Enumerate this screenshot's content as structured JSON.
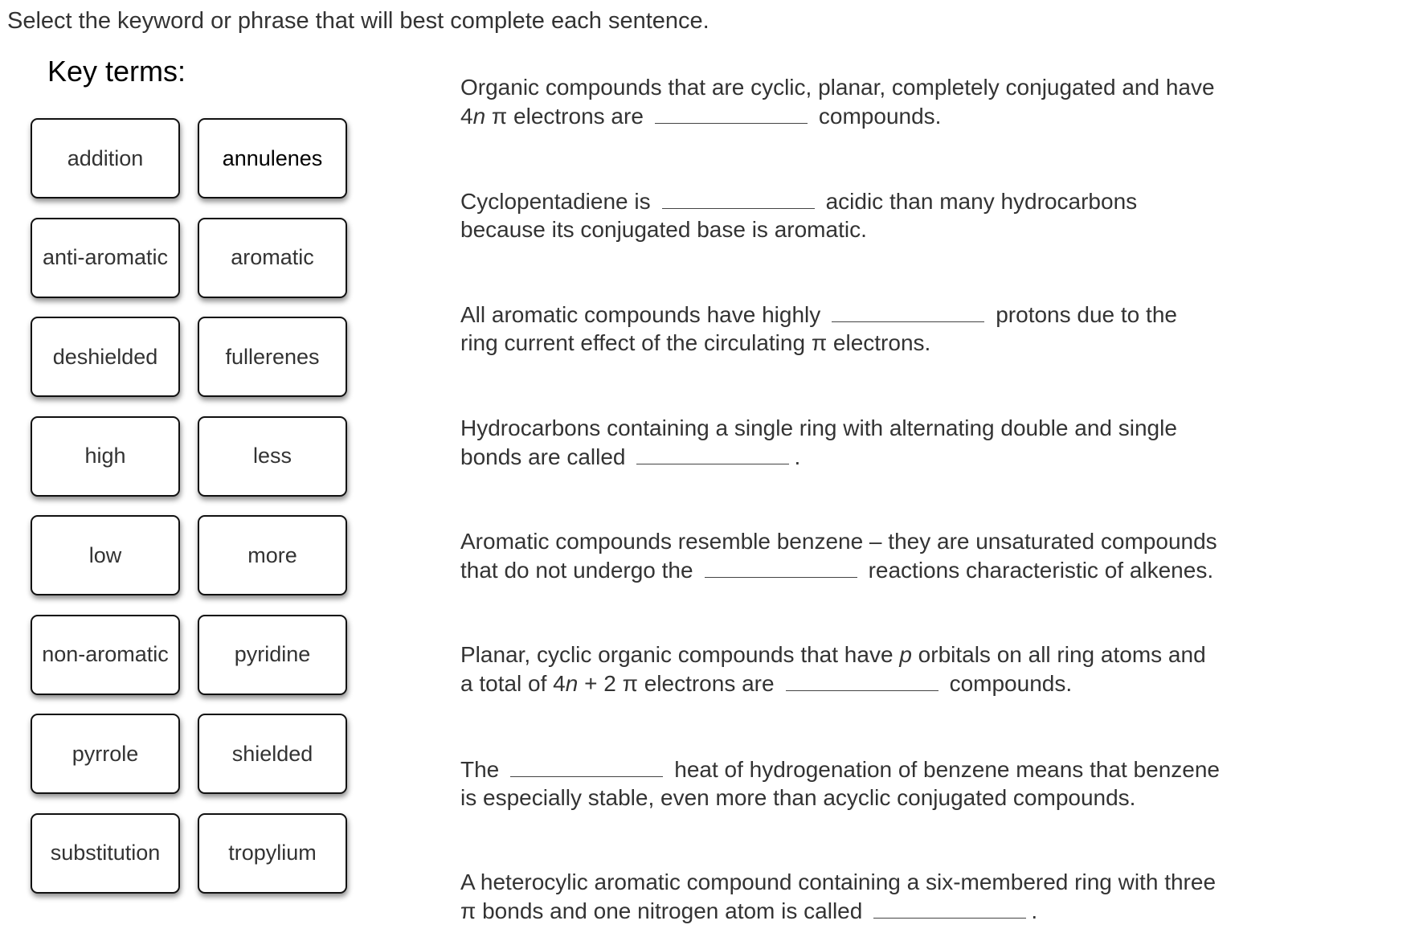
{
  "instructions": "Select the keyword or phrase that will best complete each sentence.",
  "key_terms": {
    "title": "Key terms:",
    "cards": [
      {
        "label": "addition"
      },
      {
        "label": "annulenes"
      },
      {
        "label": "anti-aromatic"
      },
      {
        "label": "aromatic"
      },
      {
        "label": "deshielded"
      },
      {
        "label": "fullerenes"
      },
      {
        "label": "high"
      },
      {
        "label": "less"
      },
      {
        "label": "low"
      },
      {
        "label": "more"
      },
      {
        "label": "non-aromatic"
      },
      {
        "label": "pyridine"
      },
      {
        "label": "pyrrole"
      },
      {
        "label": "shielded"
      },
      {
        "label": "substitution"
      },
      {
        "label": "tropylium"
      }
    ]
  },
  "sentences": [
    {
      "line1": "Organic compounds that are cyclic, planar, completely conjugated and have",
      "line2_num": "4",
      "line2_var": "n",
      "line2_before": " π electrons are",
      "line2_after": "compounds."
    },
    {
      "line1_before": "Cyclopentadiene is",
      "line1_after": "acidic than many hydrocarbons",
      "line2": "because its conjugated base is aromatic."
    },
    {
      "line1_before": "All aromatic compounds have highly",
      "line1_after": "protons due to the",
      "line2": "ring current effect of the circulating π electrons."
    },
    {
      "line1": "Hydrocarbons containing a single ring with alternating double and single",
      "line2_before": "bonds are called",
      "line2_after": "."
    },
    {
      "line1": "Aromatic compounds resemble benzene – they are unsaturated compounds",
      "line2_before": "that do not undergo the",
      "line2_after": "reactions characteristic of alkenes."
    },
    {
      "line1_before": "Planar, cyclic organic compounds that have",
      "line1_var": "p",
      "line1_after": " orbitals on all ring atoms and",
      "line2_prefix": "a total of 4",
      "line2_var": "n",
      "line2_before": " + 2 π electrons are",
      "line2_after": "compounds."
    },
    {
      "line1_before": "The",
      "line1_after": "heat of hydrogenation of benzene means that benzene",
      "line2": "is especially stable, even more than acyclic conjugated compounds."
    },
    {
      "line1": "A heterocylic aromatic compound containing a six-membered ring with three",
      "line2_before": "π bonds and one nitrogen atom is called",
      "line2_after": "."
    }
  ]
}
